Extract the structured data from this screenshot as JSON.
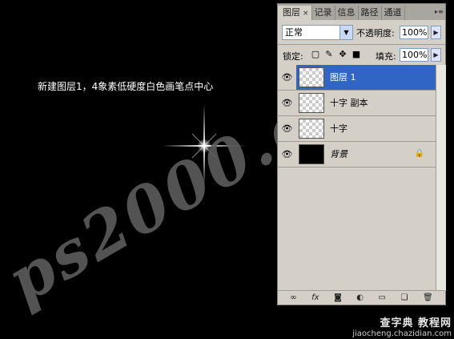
{
  "canvas": {
    "caption": "新建图层1，4象素低硬度白色画笔点中心",
    "watermark": "ps2000.c"
  },
  "panel": {
    "tabs": [
      {
        "label": "图层",
        "active": true
      },
      {
        "label": "记录",
        "active": false
      },
      {
        "label": "信息",
        "active": false
      },
      {
        "label": "路径",
        "active": false
      },
      {
        "label": "通道",
        "active": false
      }
    ],
    "tab_close": "×",
    "menu_icon": "panel-menu-icon",
    "blend_mode": "正常",
    "opacity_label": "不透明度:",
    "opacity_value": "100%",
    "lock_label": "锁定:",
    "fill_label": "填充:",
    "fill_value": "100%",
    "layers": [
      {
        "name": "图层 1",
        "selected": true,
        "thumb": "transparent",
        "italic": false,
        "locked": false
      },
      {
        "name": "十字 副本",
        "selected": false,
        "thumb": "transparent",
        "italic": false,
        "locked": false
      },
      {
        "name": "十字",
        "selected": false,
        "thumb": "transparent",
        "italic": false,
        "locked": false
      },
      {
        "name": "背景",
        "selected": false,
        "thumb": "black",
        "italic": true,
        "locked": true
      }
    ],
    "bottom_icons": [
      "link-layers-icon",
      "fx-icon",
      "mask-icon",
      "adjustment-icon",
      "folder-icon",
      "new-layer-icon",
      "trash-icon"
    ]
  },
  "corner_watermark": {
    "line1": "查字典 教程网",
    "line2": "jiaocheng.chazidian.com"
  },
  "colors": {
    "selection": "#3165c5",
    "panel_bg": "#d4d0c8"
  }
}
